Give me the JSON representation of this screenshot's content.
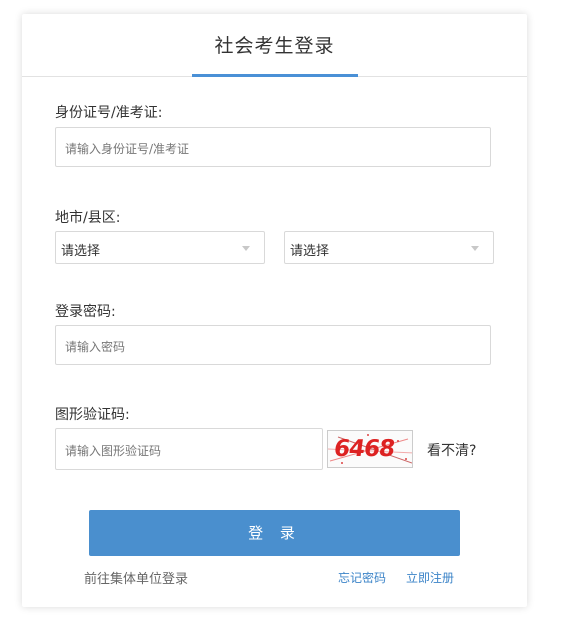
{
  "header": {
    "title": "社会考生登录"
  },
  "form": {
    "id_label": "身份证号/准考证:",
    "id_placeholder": "请输入身份证号/准考证",
    "region_label": "地市/县区:",
    "city_select": "请选择",
    "district_select": "请选择",
    "password_label": "登录密码:",
    "password_placeholder": "请输入密码",
    "captcha_label": "图形验证码:",
    "captcha_placeholder": "请输入图形验证码",
    "captcha_image_text": "6468",
    "captcha_refresh": "看不清?"
  },
  "actions": {
    "login_button": "登 录",
    "group_login_link": "前往集体单位登录",
    "forgot_password_link": "忘记密码",
    "register_link": "立即注册"
  },
  "colors": {
    "accent": "#4a8fce",
    "link": "#3c84c8",
    "captcha_text": "#dd2222"
  },
  "icons": {
    "select_caret": "chevron-down-icon"
  }
}
